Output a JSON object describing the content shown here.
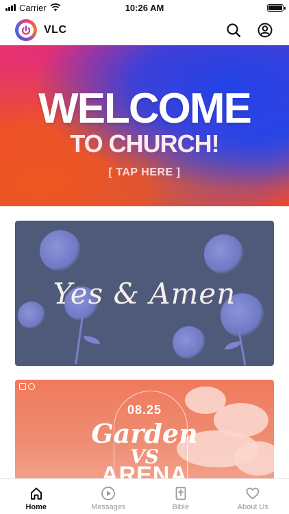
{
  "status_bar": {
    "carrier": "Carrier",
    "time": "10:26 AM"
  },
  "header": {
    "app_name": "VLC",
    "icons": [
      "search-icon",
      "account-icon"
    ]
  },
  "hero": {
    "title": "WELCOME",
    "subtitle": "TO CHURCH!",
    "cta": "[ TAP HERE ]"
  },
  "cards": [
    {
      "script_text": "Yes & Amen"
    },
    {
      "date": "08.25",
      "line1": "Garden",
      "line2": "VS",
      "line3": "ARENA"
    }
  ],
  "tabs": [
    {
      "label": "Home",
      "icon": "home-icon",
      "active": true
    },
    {
      "label": "Messages",
      "icon": "play-icon",
      "active": false
    },
    {
      "label": "Bible",
      "icon": "bible-icon",
      "active": false
    },
    {
      "label": "About Us",
      "icon": "heart-icon",
      "active": false
    }
  ],
  "colors": {
    "accent": "#111111",
    "tab_inactive": "#9a9a9a"
  }
}
